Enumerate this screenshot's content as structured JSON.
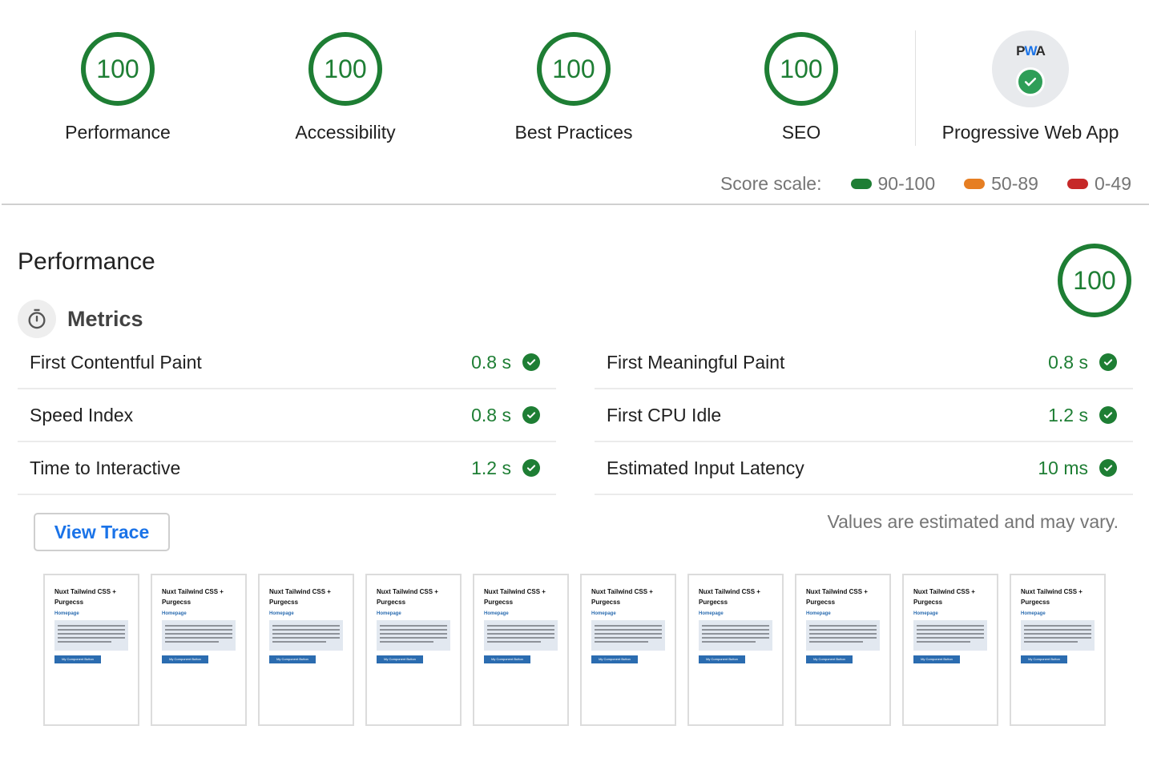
{
  "summary": {
    "categories": [
      {
        "label": "Performance",
        "score": "100"
      },
      {
        "label": "Accessibility",
        "score": "100"
      },
      {
        "label": "Best Practices",
        "score": "100"
      },
      {
        "label": "SEO",
        "score": "100"
      }
    ],
    "pwa": {
      "badge_text_p": "P",
      "badge_text_w": "W",
      "badge_text_a": "A",
      "label": "Progressive Web App",
      "icon": "check-circle-icon",
      "status": "passed"
    }
  },
  "score_scale": {
    "label": "Score scale:",
    "ranges": [
      {
        "label": "90-100",
        "color": "#1e7e34"
      },
      {
        "label": "50-89",
        "color": "#e67e22"
      },
      {
        "label": "0-49",
        "color": "#c62828"
      }
    ]
  },
  "performance": {
    "title": "Performance",
    "score": "100",
    "metrics_title": "Metrics",
    "metrics_icon": "stopwatch-icon",
    "metrics_left": [
      {
        "label": "First Contentful Paint",
        "value": "0.8 s"
      },
      {
        "label": "Speed Index",
        "value": "0.8 s"
      },
      {
        "label": "Time to Interactive",
        "value": "1.2 s"
      }
    ],
    "metrics_right": [
      {
        "label": "First Meaningful Paint",
        "value": "0.8 s"
      },
      {
        "label": "First CPU Idle",
        "value": "1.2 s"
      },
      {
        "label": "Estimated Input Latency",
        "value": "10 ms"
      }
    ],
    "view_trace_label": "View Trace",
    "disclaimer": "Values are estimated and may vary.",
    "filmstrip": {
      "frame_count": 10,
      "frame_title": "Nuxt Tailwind CSS + Purgecss",
      "frame_link": "Homepage",
      "frame_button": "My Component Button"
    }
  },
  "colors": {
    "pass": "#1e7e34",
    "link": "#1a73e8"
  }
}
